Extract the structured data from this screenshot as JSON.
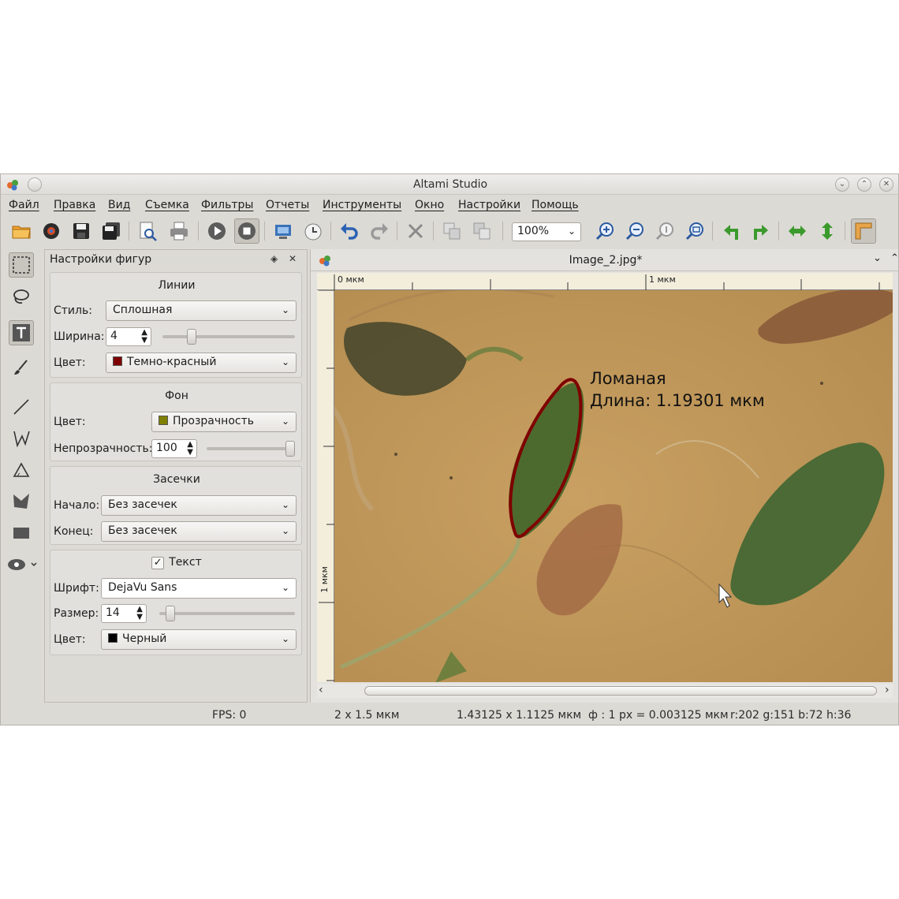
{
  "window": {
    "title": "Altami Studio"
  },
  "menu": [
    "Файл",
    "Правка",
    "Вид",
    "Съемка",
    "Фильтры",
    "Отчеты",
    "Инструменты",
    "Окно",
    "Настройки",
    "Помощь"
  ],
  "toolbar": {
    "zoom_value": "100%",
    "icons": [
      "open-folder-icon",
      "open-camera-icon",
      "save-icon",
      "save-all-icon",
      "print-preview-icon",
      "print-icon",
      "play-icon",
      "stop-icon",
      "capture-icon",
      "timer-icon",
      "undo-icon",
      "redo-icon",
      "delete-icon",
      "copy-icon",
      "paste-icon",
      "zoom-in-icon",
      "zoom-out-icon",
      "zoom-actual-icon",
      "zoom-fit-icon",
      "rotate-left-icon",
      "rotate-right-icon",
      "flip-horizontal-icon",
      "flip-vertical-icon",
      "ruler-icon"
    ]
  },
  "panel": {
    "title": "Настройки фигур",
    "lines": {
      "title": "Линии",
      "style_label": "Стиль:",
      "style_value": "Сплошная",
      "width_label": "Ширина:",
      "width_value": "4",
      "width_level": 0.2,
      "color_label": "Цвет:",
      "color_value": "Темно-красный",
      "color_hex": "#7f0000"
    },
    "fill": {
      "title": "Фон",
      "color_label": "Цвет:",
      "color_value": "Прозрачность",
      "color_hex": "#808000",
      "opacity_label": "Непрозрачность:",
      "opacity_value": "100",
      "opacity_level": 1.0
    },
    "marks": {
      "title": "Засечки",
      "start_label": "Начало:",
      "start_value": "Без засечек",
      "end_label": "Конец:",
      "end_value": "Без засечек"
    },
    "text": {
      "title": "Текст",
      "checked": true,
      "font_label": "Шрифт:",
      "font_value": "DejaVu Sans",
      "size_label": "Размер:",
      "size_value": "14",
      "size_level": 0.05,
      "color_label": "Цвет:",
      "color_value": "Черный",
      "color_hex": "#000000"
    }
  },
  "image_window": {
    "title": "Image_2.jpg*",
    "ruler_top": [
      "0 мкм",
      "1 мкм"
    ],
    "ruler_left": [
      "1 мкм"
    ],
    "annotation_line1": "Ломаная",
    "annotation_line2": "Длина: 1.19301 мкм"
  },
  "status": {
    "fps": "FPS: 0",
    "field_size": "2 x 1.5 мкм",
    "image_size": "1.43125 x 1.1125 мкм",
    "scale": "ф : 1 px = 0.003125 мкм",
    "pixel": "r:202 g:151 b:72 h:36"
  }
}
